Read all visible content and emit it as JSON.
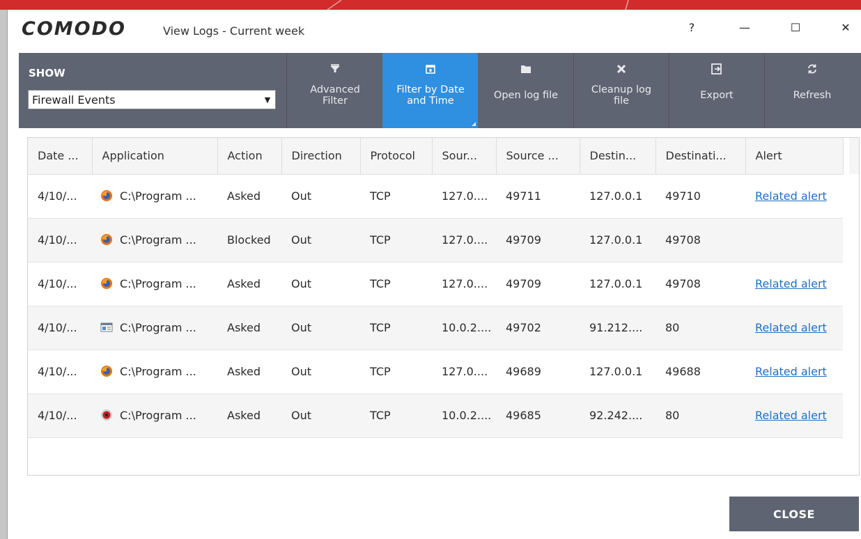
{
  "window": {
    "brand": "COMODO",
    "title": "View Logs - Current week",
    "help": "?",
    "minimize": "—",
    "maximize": "☐",
    "close": "✕"
  },
  "toolbar": {
    "show_label": "SHOW",
    "show_value": "Firewall Events",
    "buttons": [
      {
        "label": "Advanced\nFilter",
        "icon": "funnel-icon",
        "active": false
      },
      {
        "label": "Filter by Date\nand Time",
        "icon": "calendar-icon",
        "active": true
      },
      {
        "label": "Open log file",
        "icon": "folder-icon",
        "active": false
      },
      {
        "label": "Cleanup log\nfile",
        "icon": "x-icon",
        "active": false
      },
      {
        "label": "Export",
        "icon": "export-icon",
        "active": false
      },
      {
        "label": "Refresh",
        "icon": "refresh-icon",
        "active": false
      }
    ]
  },
  "table": {
    "columns": [
      "Date ...",
      "Application",
      "Action",
      "Direction",
      "Protocol",
      "Sour...",
      "Source ...",
      "Destin...",
      "Destinati...",
      "Alert"
    ],
    "rows": [
      {
        "date": "4/10/...",
        "icon": "firefox-icon",
        "app": "C:\\Program ...",
        "action": "Asked",
        "direction": "Out",
        "protocol": "TCP",
        "src_ip": "127.0....",
        "src_port": "49711",
        "dst_ip": "127.0.0.1",
        "dst_port": "49710",
        "alert": "Related alert"
      },
      {
        "date": "4/10/...",
        "icon": "firefox-icon",
        "app": "C:\\Program ...",
        "action": "Blocked",
        "direction": "Out",
        "protocol": "TCP",
        "src_ip": "127.0....",
        "src_port": "49709",
        "dst_ip": "127.0.0.1",
        "dst_port": "49708",
        "alert": ""
      },
      {
        "date": "4/10/...",
        "icon": "firefox-icon",
        "app": "C:\\Program ...",
        "action": "Asked",
        "direction": "Out",
        "protocol": "TCP",
        "src_ip": "127.0....",
        "src_port": "49709",
        "dst_ip": "127.0.0.1",
        "dst_port": "49708",
        "alert": "Related alert"
      },
      {
        "date": "4/10/...",
        "icon": "app-window-icon",
        "app": "C:\\Program ...",
        "action": "Asked",
        "direction": "Out",
        "protocol": "TCP",
        "src_ip": "10.0.2....",
        "src_port": "49702",
        "dst_ip": "91.212....",
        "dst_port": "80",
        "alert": "Related alert"
      },
      {
        "date": "4/10/...",
        "icon": "firefox-icon",
        "app": "C:\\Program ...",
        "action": "Asked",
        "direction": "Out",
        "protocol": "TCP",
        "src_ip": "127.0....",
        "src_port": "49689",
        "dst_ip": "127.0.0.1",
        "dst_port": "49688",
        "alert": "Related alert"
      },
      {
        "date": "4/10/...",
        "icon": "red-disc-icon",
        "app": "C:\\Program ...",
        "action": "Asked",
        "direction": "Out",
        "protocol": "TCP",
        "src_ip": "10.0.2....",
        "src_port": "49685",
        "dst_ip": "92.242....",
        "dst_port": "80",
        "alert": "Related alert"
      }
    ]
  },
  "footer": {
    "close_label": "CLOSE"
  },
  "colors": {
    "toolbar": "#5e6471",
    "active": "#2f8fe0",
    "link": "#1f6fc2",
    "header_strip": "#d12b2b"
  }
}
